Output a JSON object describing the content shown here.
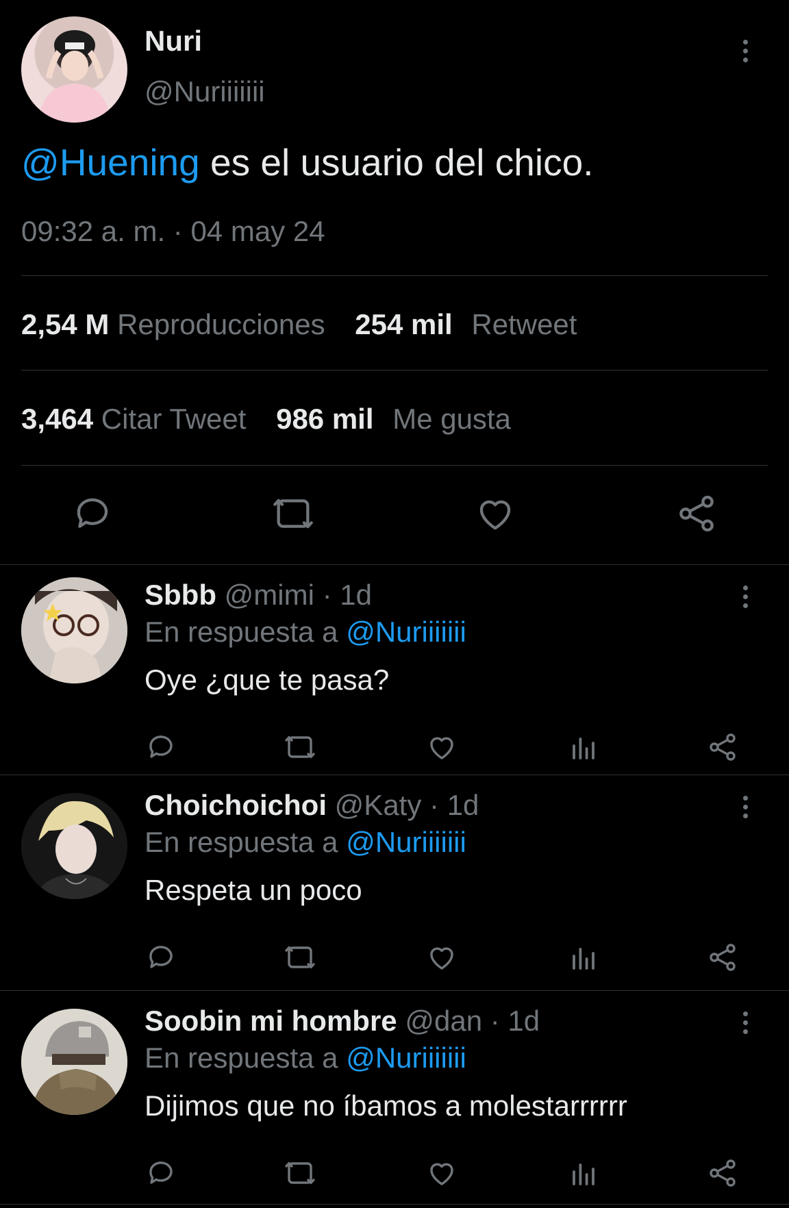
{
  "main_tweet": {
    "author_name": "Nuri",
    "author_handle": "@Nuriiiiiii",
    "mention": "@Huening",
    "text": " es el usuario del chico.",
    "timestamp": "09:32 a. m. · 04 may 24",
    "stats": {
      "views_count": "2,54 M",
      "views_label": "Reproducciones",
      "retweets_count": "254 mil",
      "retweets_label": "Retweet",
      "quotes_count": "3,464",
      "quotes_label": "Citar Tweet",
      "likes_count": "986 mil",
      "likes_label": "Me gusta"
    },
    "actions": [
      "reply-icon",
      "retweet-icon",
      "like-icon",
      "share-icon"
    ]
  },
  "replies": [
    {
      "name": "Sbbb",
      "handle": "@mimi",
      "age": "1d",
      "reply_prefix": "En respuesta a ",
      "reply_to": "@Nuriiiiiii",
      "text": "Oye ¿que te pasa?"
    },
    {
      "name": "Choichoichoi",
      "handle": "@Katy",
      "age": "1d",
      "reply_prefix": "En respuesta a ",
      "reply_to": "@Nuriiiiiii",
      "text": "Respeta un poco"
    },
    {
      "name": "Soobin mi hombre",
      "handle": "@dan",
      "age": "1d",
      "reply_prefix": "En respuesta a ",
      "reply_to": "@Nuriiiiiii",
      "text": "Dijimos que no íbamos a molestarrrrrr"
    }
  ],
  "reply_actions": [
    "reply-icon",
    "retweet-icon",
    "like-icon",
    "views-icon",
    "share-icon"
  ],
  "colors": {
    "accent": "#1d9bf0",
    "muted": "#71767b",
    "text": "#e7e9ea",
    "background": "#000000",
    "divider": "#2f3336"
  }
}
